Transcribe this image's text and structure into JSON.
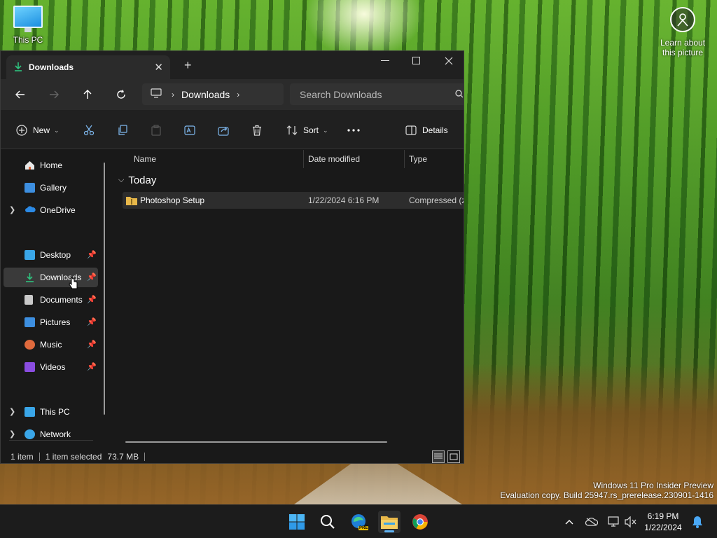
{
  "desktop": {
    "icons": [
      {
        "label": "This PC"
      }
    ],
    "learn_label_1": "Learn about",
    "learn_label_2": "this picture",
    "watermark_line1": "Windows 11 Pro Insider Preview",
    "watermark_line2": "Evaluation copy. Build 25947.rs_prerelease.230901-1416"
  },
  "explorer": {
    "tab_title": "Downloads",
    "address_crumb": "Downloads",
    "search_placeholder": "Search Downloads",
    "toolbar": {
      "new_label": "New",
      "sort_label": "Sort",
      "details_label": "Details"
    },
    "sidebar": {
      "items": [
        {
          "label": "Home",
          "icon": "home-icon",
          "color": "#e8e8e8"
        },
        {
          "label": "Gallery",
          "icon": "gallery-icon",
          "color": "#3d8fe0"
        },
        {
          "label": "OneDrive",
          "icon": "onedrive-icon",
          "color": "#2b8ae6"
        },
        {
          "label": "Desktop",
          "icon": "desktop-icon",
          "color": "#3aa6e8"
        },
        {
          "label": "Downloads",
          "icon": "download-icon",
          "color": "#2ec27e"
        },
        {
          "label": "Documents",
          "icon": "documents-icon",
          "color": "#c9c9c9"
        },
        {
          "label": "Pictures",
          "icon": "pictures-icon",
          "color": "#3d8fe0"
        },
        {
          "label": "Music",
          "icon": "music-icon",
          "color": "#e06a3d"
        },
        {
          "label": "Videos",
          "icon": "videos-icon",
          "color": "#8a4de0"
        },
        {
          "label": "This PC",
          "icon": "this-pc-icon",
          "color": "#3aa6e8"
        },
        {
          "label": "Network",
          "icon": "network-icon",
          "color": "#3aa6e8"
        }
      ]
    },
    "columns": {
      "name": "Name",
      "date": "Date modified",
      "type": "Type"
    },
    "group_label": "Today",
    "files": [
      {
        "name": "Photoshop Setup",
        "date": "1/22/2024 6:16 PM",
        "type": "Compressed (zi"
      }
    ],
    "status": {
      "count": "1 item",
      "selected": "1 item selected",
      "size": "73.7 MB"
    }
  },
  "taskbar": {
    "edge_badge": "PRE",
    "time": "6:19 PM",
    "date": "1/22/2024"
  }
}
